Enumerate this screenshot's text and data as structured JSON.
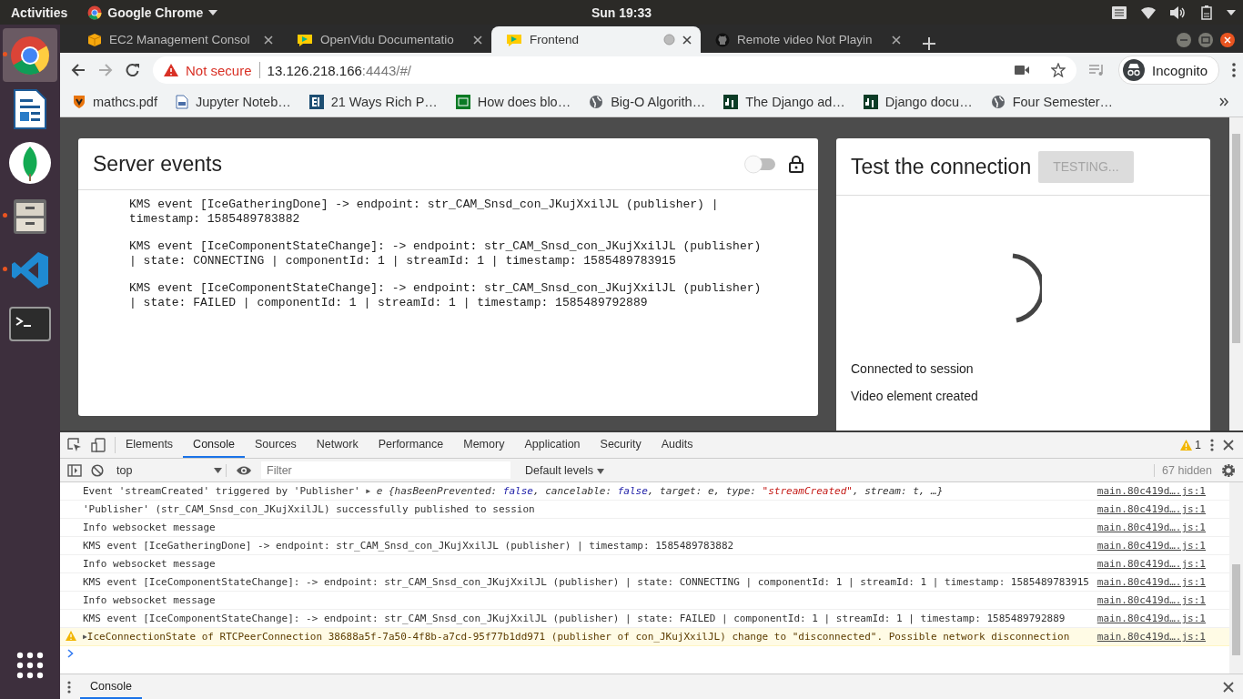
{
  "top_bar": {
    "activities": "Activities",
    "app_menu": "Google Chrome",
    "clock": "Sun 19:33"
  },
  "dock": [
    {
      "kind": "browser",
      "selected": true,
      "running": true
    },
    {
      "kind": "document",
      "selected": false,
      "running": false
    },
    {
      "kind": "leaf",
      "selected": false,
      "running": false
    },
    {
      "kind": "cabinet",
      "selected": false,
      "running": true
    },
    {
      "kind": "editor",
      "selected": false,
      "running": true
    },
    {
      "kind": "terminal",
      "selected": false,
      "running": false
    },
    {
      "kind": "grid",
      "selected": false,
      "running": false
    }
  ],
  "browser": {
    "tabs": [
      {
        "title": "EC2 Management Consol",
        "kind": "cube",
        "selected": false,
        "loading": false
      },
      {
        "title": "OpenVidu Documentatio",
        "kind": "bubble",
        "selected": false,
        "loading": false
      },
      {
        "title": "Frontend",
        "kind": "bubble",
        "selected": true,
        "loading": true
      },
      {
        "title": "Remote video Not Playin",
        "kind": "octocat",
        "selected": false,
        "loading": false
      }
    ],
    "address": {
      "security": "Not secure",
      "host": "13.126.218.166",
      "path": ":4443/#/"
    },
    "profile": "Incognito",
    "bookmarks": [
      {
        "title": "mathcs.pdf",
        "kind": "shield"
      },
      {
        "title": "Jupyter Noteb…",
        "kind": "notebook"
      },
      {
        "title": "21 Ways Rich P…",
        "kind": "bi"
      },
      {
        "title": "How does blo…",
        "kind": "greenbox"
      },
      {
        "title": "Big-O Algorith…",
        "kind": "globe"
      },
      {
        "title": "The Django ad…",
        "kind": "dj"
      },
      {
        "title": "Django docu…",
        "kind": "dj"
      },
      {
        "title": "Four Semester…",
        "kind": "globe"
      }
    ]
  },
  "server_events": {
    "title": "Server events",
    "toggle_on": false,
    "events": [
      "KMS event [IceGatheringDone] -> endpoint: str_CAM_Snsd_con_JKujXxilJL (publisher) | timestamp: 1585489783882",
      "KMS event [IceComponentStateChange]: -> endpoint: str_CAM_Snsd_con_JKujXxilJL (publisher) | state: CONNECTING | componentId: 1 | streamId: 1 | timestamp: 1585489783915",
      "KMS event [IceComponentStateChange]: -> endpoint: str_CAM_Snsd_con_JKujXxilJL (publisher) | state: FAILED | componentId: 1 | streamId: 1 | timestamp: 1585489792889"
    ]
  },
  "test_connection": {
    "title": "Test the connection",
    "button": "TESTING...",
    "button_disabled": true,
    "statuses": [
      "Connected to session",
      "Video element created"
    ]
  },
  "devtools": {
    "tabs": [
      {
        "label": "Elements",
        "selected": false
      },
      {
        "label": "Console",
        "selected": true
      },
      {
        "label": "Sources",
        "selected": false
      },
      {
        "label": "Network",
        "selected": false
      },
      {
        "label": "Performance",
        "selected": false
      },
      {
        "label": "Memory",
        "selected": false
      },
      {
        "label": "Application",
        "selected": false
      },
      {
        "label": "Security",
        "selected": false
      },
      {
        "label": "Audits",
        "selected": false
      }
    ],
    "warning_count": "1",
    "context": "top",
    "filter_placeholder": "Filter",
    "levels": "Default levels",
    "hidden": "67 hidden",
    "messages": [
      {
        "kind": "log",
        "source": "main.80c419d….js:1",
        "parts": [
          {
            "kind": "plain",
            "text": "Event 'streamCreated' triggered by 'Publisher' "
          },
          {
            "kind": "toggle",
            "text": "▶"
          },
          {
            "kind": "italic",
            "text": " e {hasBeenPrevented: "
          },
          {
            "kind": "keyword",
            "text": "false"
          },
          {
            "kind": "italic",
            "text": ", cancelable: "
          },
          {
            "kind": "keyword",
            "text": "false"
          },
          {
            "kind": "italic",
            "text": ", target: e, type: "
          },
          {
            "kind": "string",
            "text": "\"streamCreated\""
          },
          {
            "kind": "italic",
            "text": ", stream: t, …}"
          }
        ]
      },
      {
        "kind": "log",
        "source": "main.80c419d….js:1",
        "parts": [
          {
            "kind": "plain",
            "text": "'Publisher' (str_CAM_Snsd_con_JKujXxilJL) successfully published to session"
          }
        ]
      },
      {
        "kind": "log",
        "source": "main.80c419d….js:1",
        "parts": [
          {
            "kind": "plain",
            "text": "Info websocket message"
          }
        ]
      },
      {
        "kind": "log",
        "source": "main.80c419d….js:1",
        "parts": [
          {
            "kind": "plain",
            "text": "KMS event [IceGatheringDone] -> endpoint: str_CAM_Snsd_con_JKujXxilJL (publisher) | timestamp: 1585489783882"
          }
        ]
      },
      {
        "kind": "log",
        "source": "main.80c419d….js:1",
        "parts": [
          {
            "kind": "plain",
            "text": "Info websocket message"
          }
        ]
      },
      {
        "kind": "log",
        "source": "main.80c419d….js:1",
        "parts": [
          {
            "kind": "plain",
            "text": "KMS event [IceComponentStateChange]: -> endpoint: str_CAM_Snsd_con_JKujXxilJL (publisher) | state: CONNECTING | componentId: 1 | streamId: 1 | timestamp: 1585489783915"
          }
        ]
      },
      {
        "kind": "log",
        "source": "main.80c419d….js:1",
        "parts": [
          {
            "kind": "plain",
            "text": "Info websocket message"
          }
        ]
      },
      {
        "kind": "log",
        "source": "main.80c419d….js:1",
        "parts": [
          {
            "kind": "plain",
            "text": "KMS event [IceComponentStateChange]: -> endpoint: str_CAM_Snsd_con_JKujXxilJL (publisher) | state: FAILED | componentId: 1 | streamId: 1 | timestamp: 1585489792889"
          }
        ]
      },
      {
        "kind": "warning",
        "source": "main.80c419d….js:1",
        "parts": [
          {
            "kind": "toggle",
            "text": "▶"
          },
          {
            "kind": "plain",
            "text": "IceConnectionState of RTCPeerConnection 38688a5f-7a50-4f8b-a7cd-95f77b1dd971 (publisher of con_JKujXxilJL) change to \"disconnected\". Possible network disconnection"
          }
        ]
      }
    ],
    "drawer_tabs": [
      {
        "label": "Console",
        "selected": true
      }
    ]
  }
}
